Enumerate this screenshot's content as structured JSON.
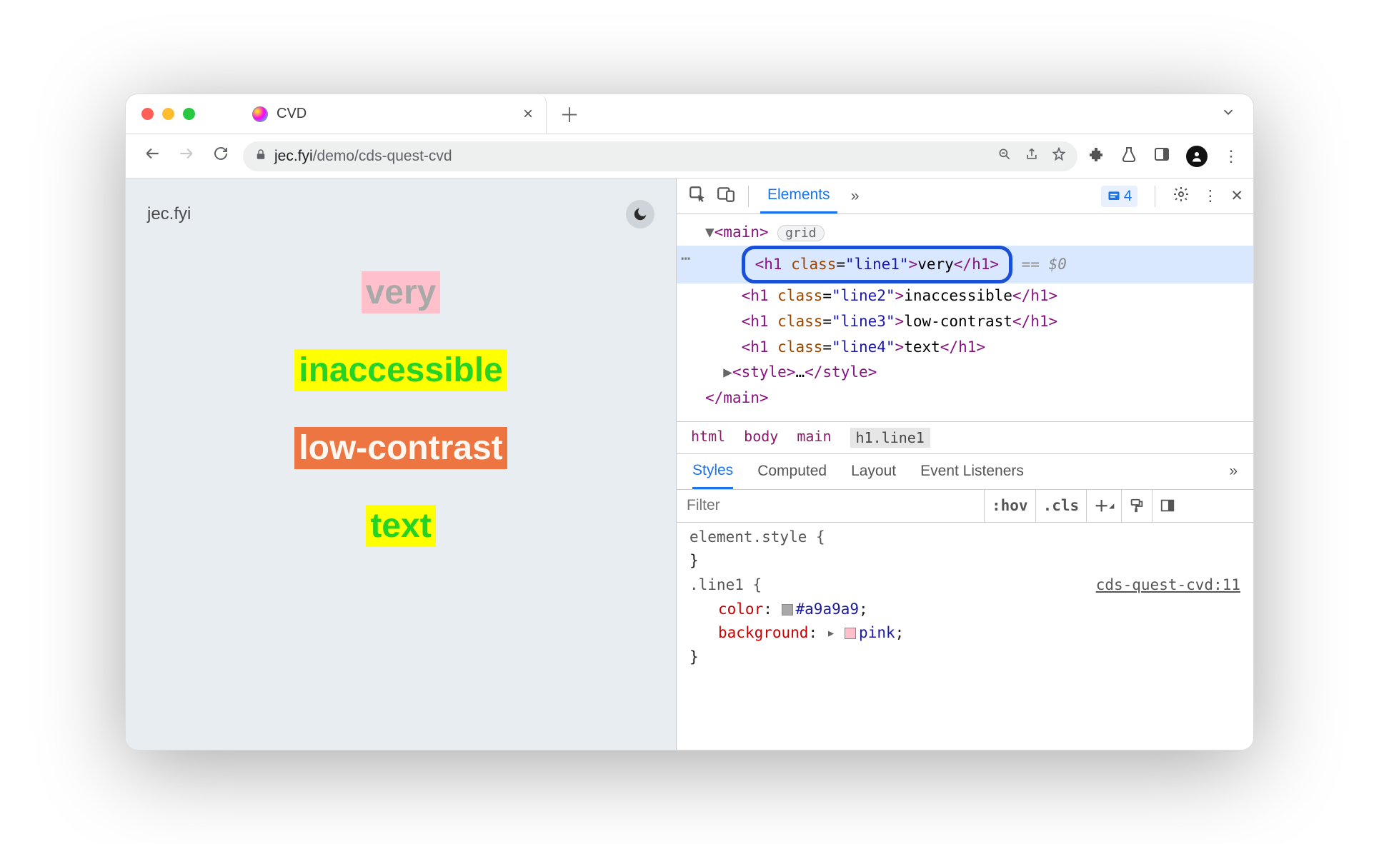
{
  "tab": {
    "title": "CVD"
  },
  "toolbar": {
    "url_host": "jec.fyi",
    "url_path": "/demo/cds-quest-cvd"
  },
  "page": {
    "site_name": "jec.fyi",
    "line1": "very",
    "line2": "inaccessible",
    "line3": "low-contrast",
    "line4": "text"
  },
  "devtools": {
    "panel_elements": "Elements",
    "issues_count": "4",
    "dom": {
      "main_open": "<main>",
      "main_badge": "grid",
      "h1_line1_open": "<h1 class=\"line1\">",
      "h1_line1_text": "very",
      "h1_line1_close": "</h1>",
      "eq0": " == $0",
      "h1_line2": "<h1 class=\"line2\">inaccessible</h1>",
      "h1_line3": "<h1 class=\"line3\">low-contrast</h1>",
      "h1_line4": "<h1 class=\"line4\">text</h1>",
      "style_row": "<style>…</style>",
      "main_close": "</main>"
    },
    "breadcrumb": {
      "html": "html",
      "body": "body",
      "main": "main",
      "h1": "h1.line1"
    },
    "styles_tabs": {
      "styles": "Styles",
      "computed": "Computed",
      "layout": "Layout",
      "listeners": "Event Listeners"
    },
    "filter": {
      "placeholder": "Filter",
      "hov": ":hov",
      "cls": ".cls"
    },
    "styles": {
      "element_style": "element.style {",
      "element_style_close": "}",
      "rule_selector": ".line1 {",
      "rule_source": "cds-quest-cvd:11",
      "prop_color": "color",
      "val_color": "#a9a9a9",
      "prop_bg": "background",
      "val_bg": "pink",
      "rule_close": "}"
    }
  }
}
